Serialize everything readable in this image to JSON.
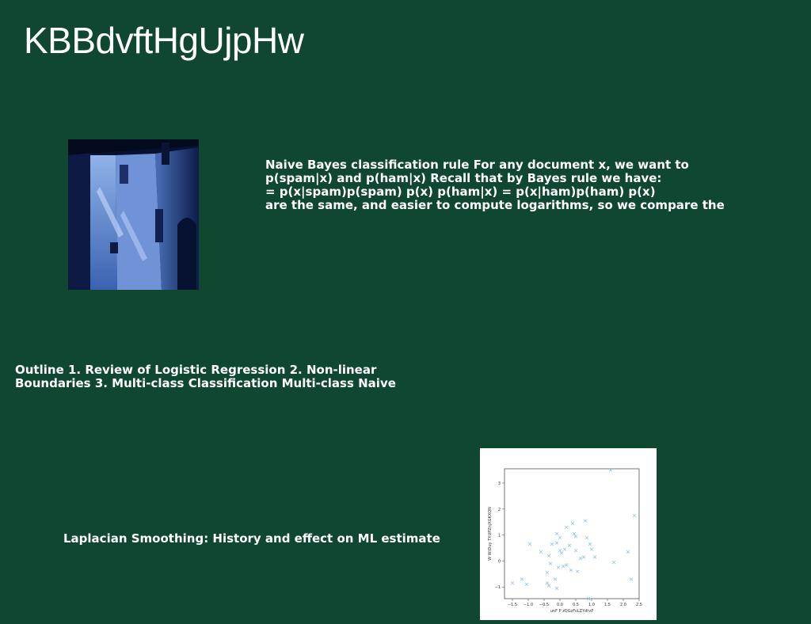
{
  "slide": {
    "title": "KBBdvftHgUjpHw",
    "paragraph_lines": [
      "Naive Bayes classification rule For any document x, we want to",
      "p(spam|x) and p(ham|x) Recall that by Bayes rule we have:",
      "= p(x|spam)p(spam) p(x) p(ham|x) = p(x|ham)p(ham) p(x)",
      "are the same, and easier to compute logarithms, so we compare the"
    ],
    "outline_lines": [
      "Outline 1. Review of Logistic Regression 2. Non-linear",
      "Boundaries 3. Multi-class Classification Multi-class Naive"
    ],
    "laplace_caption": "Laplacian Smoothing: History and effect on ML estimate"
  },
  "colors": {
    "background": "#0f4731",
    "text": "#ffffff",
    "marker": "#8ec3ea"
  },
  "chart_data": {
    "type": "scatter",
    "marker": "x",
    "xlabel": "unF P zQGzFcLZYdtvP",
    "ylabel": "W WtDuy TXUPZnjXGKXQN",
    "xlim": [
      -1.75,
      2.5
    ],
    "ylim": [
      -1.45,
      3.55
    ],
    "xticks": [
      "−1.5",
      "−1.0",
      "−0.5",
      "0.0",
      "0.5",
      "1.0",
      "1.5",
      "2.0",
      "2.5"
    ],
    "xtick_values": [
      -1.5,
      -1.0,
      -0.5,
      0.0,
      0.5,
      1.0,
      1.5,
      2.0,
      2.5
    ],
    "yticks": [
      "−1",
      "0",
      "1",
      "2",
      "3"
    ],
    "ytick_values": [
      -1,
      0,
      1,
      2,
      3
    ],
    "points": [
      [
        -1.5,
        -0.85
      ],
      [
        -1.2,
        -0.7
      ],
      [
        -1.05,
        -0.9
      ],
      [
        -0.95,
        0.65
      ],
      [
        -0.6,
        0.35
      ],
      [
        -0.4,
        -0.45
      ],
      [
        -0.4,
        -0.85
      ],
      [
        -0.35,
        -0.95
      ],
      [
        -0.35,
        0.2
      ],
      [
        -0.3,
        -0.1
      ],
      [
        -0.25,
        0.65
      ],
      [
        -0.15,
        -0.7
      ],
      [
        -0.1,
        0.7
      ],
      [
        -0.1,
        1.05
      ],
      [
        -0.1,
        -1.05
      ],
      [
        -0.05,
        -0.25
      ],
      [
        0.0,
        0.4
      ],
      [
        0.0,
        0.9
      ],
      [
        0.05,
        0.3
      ],
      [
        0.1,
        -0.2
      ],
      [
        0.15,
        0.45
      ],
      [
        0.2,
        1.3
      ],
      [
        0.2,
        -0.15
      ],
      [
        0.3,
        0.6
      ],
      [
        0.35,
        -0.35
      ],
      [
        0.4,
        1.45
      ],
      [
        0.45,
        1.05
      ],
      [
        0.5,
        0.95
      ],
      [
        0.5,
        0.4
      ],
      [
        0.55,
        -0.4
      ],
      [
        0.65,
        0.1
      ],
      [
        0.75,
        0.15
      ],
      [
        0.8,
        1.55
      ],
      [
        0.85,
        0.9
      ],
      [
        0.9,
        -1.45
      ],
      [
        0.95,
        0.65
      ],
      [
        1.0,
        0.45
      ],
      [
        1.1,
        0.15
      ],
      [
        1.6,
        3.5
      ],
      [
        1.7,
        -0.05
      ],
      [
        2.15,
        0.35
      ],
      [
        2.25,
        -0.7
      ],
      [
        2.35,
        1.75
      ]
    ]
  }
}
